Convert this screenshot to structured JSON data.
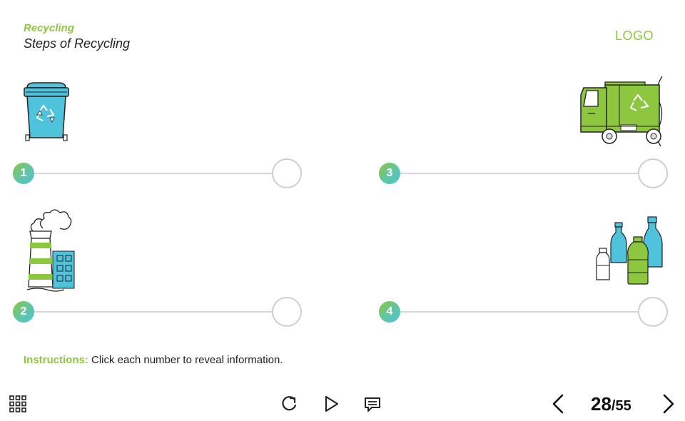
{
  "header": {
    "category": "Recycling",
    "title": "Steps of Recycling",
    "logo": "LOGO"
  },
  "steps": [
    {
      "number": "1",
      "illustration": "recycling-bin-icon"
    },
    {
      "number": "2",
      "illustration": "factory-icon"
    },
    {
      "number": "3",
      "illustration": "garbage-truck-icon"
    },
    {
      "number": "4",
      "illustration": "bottles-icon"
    }
  ],
  "instructions": {
    "label": "Instructions:",
    "text": " Click each number to reveal information."
  },
  "controls": {
    "menu_icon": "grid-menu-icon",
    "replay_icon": "replay-icon",
    "play_icon": "play-icon",
    "comment_icon": "comment-icon",
    "prev_icon": "chevron-left-icon",
    "next_icon": "chevron-right-icon"
  },
  "pagination": {
    "current": "28",
    "total": "/55"
  },
  "colors": {
    "accent_green": "#8dc63f",
    "accent_blue": "#4fc3dc",
    "line_gray": "#d6d6d6"
  }
}
